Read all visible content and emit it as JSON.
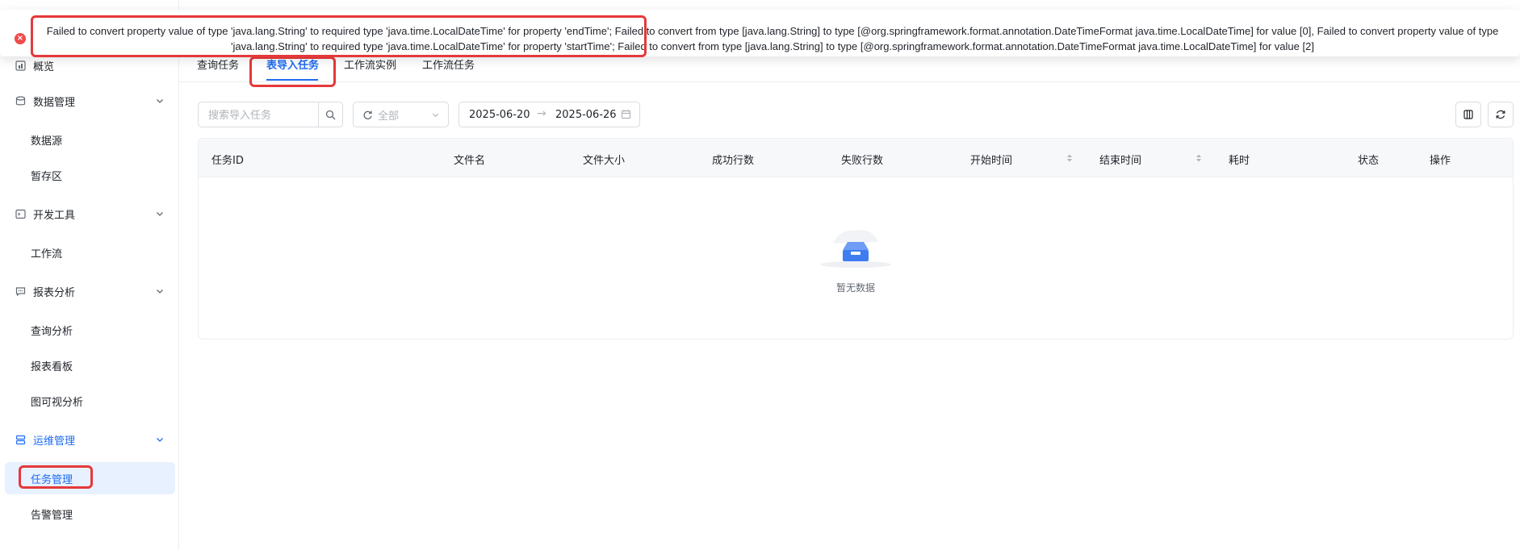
{
  "error_toast": {
    "message": "Failed to convert property value of type 'java.lang.String' to required type 'java.time.LocalDateTime' for property 'endTime'; Failed to convert from type [java.lang.String] to type [@org.springframework.format.annotation.DateTimeFormat java.time.LocalDateTime] for value [0], Failed to convert property value of type 'java.lang.String' to required type 'java.time.LocalDateTime' for property 'startTime'; Failed to convert from type [java.lang.String] to type [@org.springframework.format.annotation.DateTimeFormat java.time.LocalDateTime] for value [2]",
    "icon": "error-icon",
    "color": "#f04b4b"
  },
  "sidebar": {
    "overview": "概览",
    "groups": [
      {
        "label": "数据管理",
        "icon": "database-icon",
        "items": [
          "数据源",
          "暂存区"
        ]
      },
      {
        "label": "开发工具",
        "icon": "terminal-icon",
        "items": [
          "工作流"
        ]
      },
      {
        "label": "报表分析",
        "icon": "chat-icon",
        "items": [
          "查询分析",
          "报表看板",
          "图可视分析"
        ]
      },
      {
        "label": "运维管理",
        "icon": "server-icon",
        "items": [
          "任务管理",
          "告警管理"
        ]
      }
    ],
    "active_item": "任务管理",
    "accent": "#1f6bf0"
  },
  "tabs": [
    "查询任务",
    "表导入任务",
    "工作流实例",
    "工作流任务"
  ],
  "active_tab": "表导入任务",
  "toolbar": {
    "search_placeholder": "搜索导入任务",
    "status_value": "全部",
    "date_start": "2025-06-20",
    "date_separator": "→",
    "date_end": "2025-06-26"
  },
  "table": {
    "columns": [
      "任务ID",
      "文件名",
      "文件大小",
      "成功行数",
      "失败行数",
      "开始时间",
      "结束时间",
      "耗时",
      "状态",
      "操作"
    ],
    "empty_text": "暂无数据"
  }
}
